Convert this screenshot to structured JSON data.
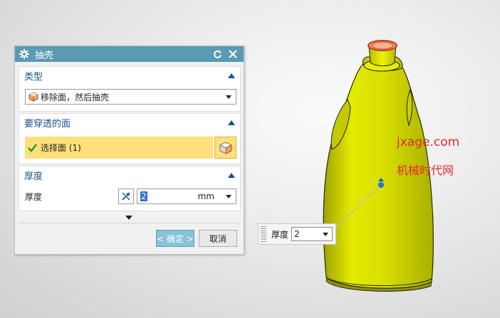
{
  "dialog": {
    "title": "抽壳",
    "type_section": {
      "header": "类型",
      "selected_type": "移除面，然后抽壳"
    },
    "pierce_section": {
      "header": "要穿透的面",
      "select_label": "选择面 (1)"
    },
    "thickness_section": {
      "header": "厚度",
      "label": "厚度",
      "value": "2",
      "unit": "mm"
    },
    "ok_label": "< 确定 >",
    "cancel_label": "取消"
  },
  "floating_input": {
    "label": "厚度",
    "value": "2"
  },
  "watermark": {
    "line1": "jxage.com",
    "line2": "机械时代网"
  },
  "colors": {
    "titlebar": "#5a9ab2",
    "section_header": "#17538f",
    "selection_highlight": "#ffe07a",
    "model_yellow": "#d8df00",
    "watermark": "#e22a2a"
  }
}
